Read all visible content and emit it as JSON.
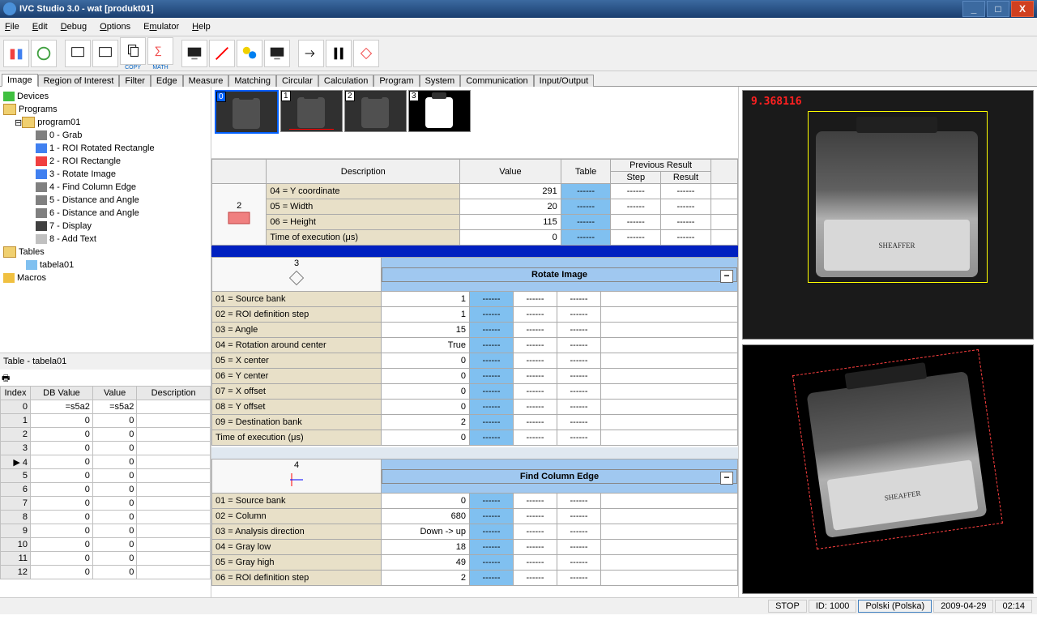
{
  "title": "IVC Studio 3.0 - wat   [produkt01]",
  "menu": {
    "file": "File",
    "edit": "Edit",
    "debug": "Debug",
    "options": "Options",
    "emulator": "Emulator",
    "help": "Help"
  },
  "toolbar_caps": {
    "copy": "COPY",
    "math": "MATH"
  },
  "tabs": [
    "Image",
    "Region of Interest",
    "Filter",
    "Edge",
    "Measure",
    "Matching",
    "Circular",
    "Calculation",
    "Program",
    "System",
    "Communication",
    "Input/Output"
  ],
  "tree": {
    "devices": "Devices",
    "programs": "Programs",
    "program01": "program01",
    "steps": [
      "0 - Grab",
      "1 - ROI Rotated Rectangle",
      "2 - ROI Rectangle",
      "3 - Rotate Image",
      "4 - Find Column Edge",
      "5 - Distance and Angle",
      "6 - Distance and Angle",
      "7 - Display",
      "8 - Add Text"
    ],
    "tables": "Tables",
    "tabela01": "tabela01",
    "macros": "Macros"
  },
  "tablepane": {
    "title": "Table - tabela01",
    "headers": [
      "Index",
      "DB Value",
      "Value",
      "Description"
    ],
    "rows": [
      {
        "i": 0,
        "db": "=s5a2",
        "v": "=s5a2"
      },
      {
        "i": 1,
        "db": "0",
        "v": "0"
      },
      {
        "i": 2,
        "db": "0",
        "v": "0"
      },
      {
        "i": 3,
        "db": "0",
        "v": "0"
      },
      {
        "i": 4,
        "db": "0",
        "v": "0"
      },
      {
        "i": 5,
        "db": "0",
        "v": "0"
      },
      {
        "i": 6,
        "db": "0",
        "v": "0"
      },
      {
        "i": 7,
        "db": "0",
        "v": "0"
      },
      {
        "i": 8,
        "db": "0",
        "v": "0"
      },
      {
        "i": 9,
        "db": "0",
        "v": "0"
      },
      {
        "i": 10,
        "db": "0",
        "v": "0"
      },
      {
        "i": 11,
        "db": "0",
        "v": "0"
      },
      {
        "i": 12,
        "db": "0",
        "v": "0"
      }
    ]
  },
  "thumbs": [
    0,
    1,
    2,
    3
  ],
  "headers": {
    "desc": "Description",
    "val": "Value",
    "tbl": "Table",
    "prev": "Previous Result",
    "step": "Step",
    "res": "Result"
  },
  "block_top": {
    "num": "2",
    "rows": [
      {
        "d": "04 = Y coordinate",
        "v": "291"
      },
      {
        "d": "05 = Width",
        "v": "20"
      },
      {
        "d": "06 = Height",
        "v": "115"
      },
      {
        "d": "Time of execution (μs)",
        "v": "0"
      }
    ]
  },
  "block_rotate": {
    "title": "Rotate Image",
    "num": "3",
    "rows": [
      {
        "d": "01 = Source bank",
        "v": "1"
      },
      {
        "d": "02 = ROI definition step",
        "v": "1"
      },
      {
        "d": "03 = Angle",
        "v": "15"
      },
      {
        "d": "04 = Rotation around center",
        "v": "True"
      },
      {
        "d": "05 = X center",
        "v": "0"
      },
      {
        "d": "06 = Y center",
        "v": "0"
      },
      {
        "d": "07 = X offset",
        "v": "0"
      },
      {
        "d": "08 = Y offset",
        "v": "0"
      },
      {
        "d": "09 = Destination bank",
        "v": "2"
      },
      {
        "d": "Time of execution (μs)",
        "v": "0"
      }
    ]
  },
  "block_find": {
    "title": "Find Column Edge",
    "num": "4",
    "rows": [
      {
        "d": "01 = Source bank",
        "v": "0"
      },
      {
        "d": "02 = Column",
        "v": "680"
      },
      {
        "d": "03 = Analysis direction",
        "v": "Down -> up"
      },
      {
        "d": "04 = Gray low",
        "v": "18"
      },
      {
        "d": "05 = Gray high",
        "v": "49"
      },
      {
        "d": "06 = ROI definition step",
        "v": "2"
      }
    ]
  },
  "dash": "------",
  "preview_overlay": "9.368116",
  "bottle_label": "SHEAFFER",
  "status": {
    "stop": "STOP",
    "id": "ID: 1000",
    "lang": "Polski (Polska)",
    "date": "2009-04-29",
    "time": "02:14"
  }
}
